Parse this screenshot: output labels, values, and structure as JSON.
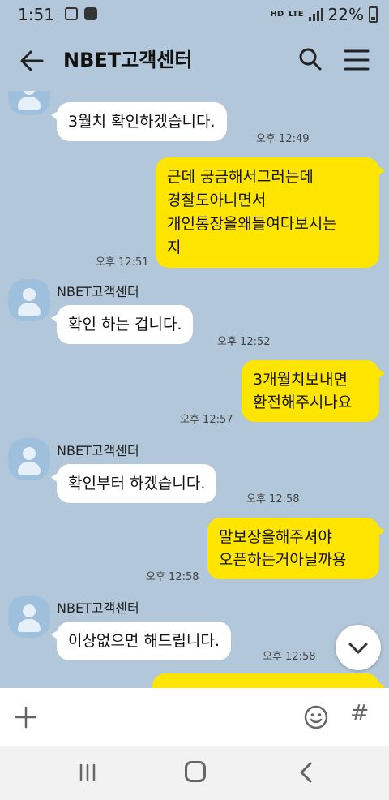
{
  "status_bar": {
    "time": "1:51",
    "hd_label": "HD",
    "lte_label": "LTE",
    "battery": "22%"
  },
  "header": {
    "title": "NBET고객센터"
  },
  "messages": {
    "m0_time": "오후 12:49",
    "m0_text": "3월치 확인하겠습니다.",
    "m1_lines": [
      "근데 궁금해서그러는데",
      "경찰도아니면서",
      "개인통장을왜들여다보시는",
      "지"
    ],
    "m1_time": "오후 12:51",
    "m2_sender": "NBET고객센터",
    "m2_text": "확인 하는 겁니다.",
    "m2_time": "오후 12:52",
    "m3_lines": [
      "3개월치보내면",
      "환전해주시나요"
    ],
    "m3_time": "오후 12:57",
    "m4_sender": "NBET고객센터",
    "m4_text": "확인부터 하겠습니다.",
    "m4_time": "오후 12:58",
    "m5_lines": [
      "말보장을해주셔야",
      "오픈하는거아닐까용"
    ],
    "m5_time": "오후 12:58",
    "m6_sender": "NBET고객센터",
    "m6_text": "이상없으면 해드립니다.",
    "m6_time": "오후 12:58"
  },
  "input_bar": {
    "hash_symbol": "#"
  },
  "colors": {
    "chat_bg": "#b2c7d9",
    "outgoing_bubble": "#fee500",
    "incoming_bubble": "#ffffff"
  },
  "icons": [
    "back-arrow-icon",
    "search-icon",
    "hamburger-menu-icon",
    "avatar-icon",
    "chevron-down-icon",
    "plus-icon",
    "emoji-icon",
    "hash-icon",
    "nav-recent-apps-icon",
    "nav-home-icon",
    "nav-back-icon"
  ]
}
